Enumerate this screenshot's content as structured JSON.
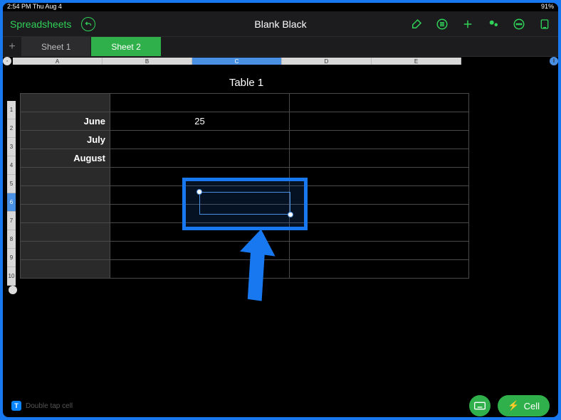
{
  "status": {
    "left": "2:54 PM  Thu Aug 4",
    "right": "91%"
  },
  "toolbar": {
    "back": "Spreadsheets",
    "title": "Blank Black"
  },
  "sheets": {
    "tabs": [
      "Sheet 1",
      "Sheet 2"
    ],
    "active_index": 1
  },
  "columns": [
    "A",
    "B",
    "C",
    "D",
    "E"
  ],
  "rows": [
    "1",
    "2",
    "3",
    "4",
    "5",
    "6",
    "7",
    "8",
    "9",
    "10"
  ],
  "table": {
    "title": "Table 1",
    "row_headers": [
      "",
      "June",
      "July",
      "August",
      "",
      "",
      "",
      "",
      "",
      ""
    ],
    "colB": [
      "",
      "25",
      "",
      "",
      "",
      "",
      "",
      "",
      "",
      ""
    ]
  },
  "bottom": {
    "badge": "T",
    "hint": "Double tap cell",
    "cell_btn": "Cell"
  },
  "colors": {
    "accent": "#30d158",
    "selection": "#1878F0"
  }
}
